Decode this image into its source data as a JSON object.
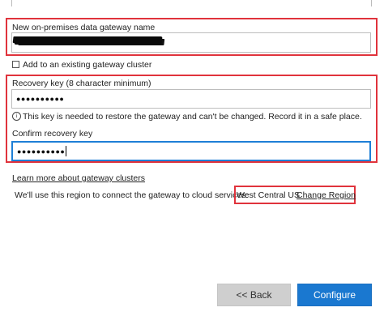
{
  "gateway_name": {
    "label": "New on-premises data gateway name",
    "value": ""
  },
  "add_to_cluster": {
    "label": "Add to an existing gateway cluster",
    "checked": false
  },
  "recovery_key": {
    "label": "Recovery key (8 character minimum)",
    "value": "●●●●●●●●●●",
    "info": "This key is needed to restore the gateway and can't be changed. Record it in a safe place."
  },
  "confirm_key": {
    "label": "Confirm recovery key",
    "value": "●●●●●●●●●●"
  },
  "learn_more_link": "Learn more about gateway clusters",
  "region": {
    "text": "We'll use this region to connect the gateway to cloud services:",
    "value": "West Central US",
    "change_link": "Change Region"
  },
  "buttons": {
    "back": "<< Back",
    "configure": "Configure"
  },
  "colors": {
    "highlight": "#e0333c",
    "accent": "#1a78d0",
    "focus": "#1e7fd6"
  }
}
